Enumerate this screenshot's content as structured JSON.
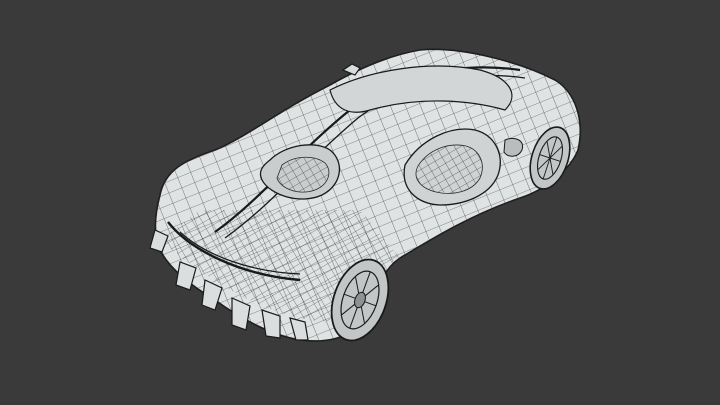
{
  "viewport": {
    "background": "#3a3a3a",
    "subject": "wireframe-sports-car",
    "render_style": "wireframe",
    "surface_color": "#dfe3e3",
    "wire_color": "#1f1f1f",
    "shadow_color": "#9ea3a3"
  }
}
